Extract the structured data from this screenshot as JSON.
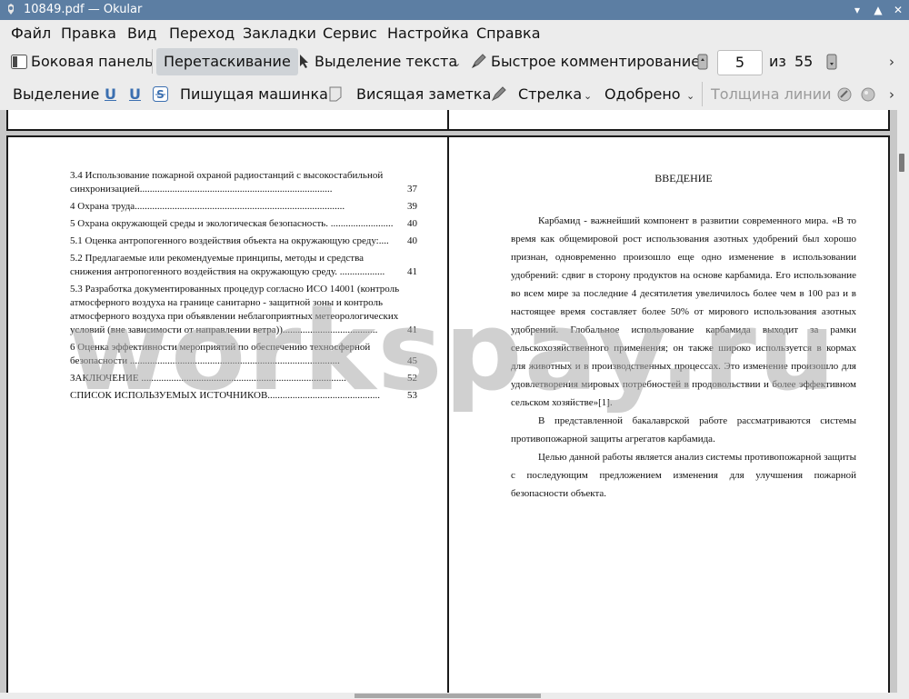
{
  "window": {
    "title": "10849.pdf  — Okular"
  },
  "menu": [
    "Файл",
    "Правка",
    "Вид",
    "Переход",
    "Закладки",
    "Сервис",
    "Настройка",
    "Справка"
  ],
  "toolbar1": {
    "sidebar": "Боковая панель",
    "browse": "Перетаскивание",
    "text_select": "Выделение текста",
    "quick_annot": "Быстрое комментирование",
    "page_current": "5",
    "of": "из",
    "page_total": "55"
  },
  "toolbar2": {
    "selection": "Выделение",
    "typewriter": "Пишущая машинка",
    "note": "Висящая заметка",
    "arrow": "Стрелка",
    "stamp": "Одобрено",
    "line_width": "Толщина линии"
  },
  "left_page": {
    "toc": [
      {
        "text": "3.4      Использование пожарной охраной радиостанций с высокостабильной синхронизацией.............................................................................",
        "page": "37"
      },
      {
        "text": "4 Охрана труда....................................................................................",
        "page": "39"
      },
      {
        "text": "5 Охрана окружающей среды и экологическая безопасность. .........................",
        "page": "40"
      },
      {
        "text": "5.1 Оценка антропогенного воздействия объекта на окружающую среду:....",
        "page": "40"
      },
      {
        "text": "5.2 Предлагаемые или рекомендуемые принципы, методы и средства снижения антропогенного воздействия на окружающую среду. ..................",
        "page": "41"
      },
      {
        "text": "5.3 Разработка документированных процедур согласно ИСО 14001 (контроль атмосферного воздуха на границе санитарно - защитной зоны и контроль атмосферного воздуха при объявлении неблагоприятных метеорологических условий (вне зависимости от направлении ветра))......................................",
        "page": "41"
      },
      {
        "text": "6 Оценка эффективности мероприятий по обеспечению техносферной безопасности ....................................................................................",
        "page": "45"
      },
      {
        "text": "ЗАКЛЮЧЕНИЕ ..................................................................................",
        "page": "52"
      },
      {
        "text": "СПИСОК ИСПОЛЬЗУЕМЫХ ИСТОЧНИКОВ.............................................",
        "page": "53"
      }
    ]
  },
  "right_page": {
    "heading": "ВВЕДЕНИЕ",
    "p1": "Карбамид - важнейший компонент в развитии современного мира. «В то время как общемировой рост использования азотных удобрений был хорошо признан, одновременно произошло еще одно изменение в использовании удобрений: сдвиг в сторону продуктов на основе карбамида. Его использование во всем мире за последние 4 десятилетия увеличилось более чем в 100 раз и в настоящее время составляет более 50% от мирового использования азотных удобрений. Глобальное использование карбамида выходит за рамки сельскохозяйственного применения; он также широко используется в кормах для животных и в производственных процессах. Это изменение произошло для удовлетворения мировых потребностей в продовольствии и более эффективном сельском хозяйстве»[1].",
    "p2": "В представленной бакалаврской работе рассматриваются системы противопожарной защиты агрегатов карбамида.",
    "p3": "Целью данной работы является анализ системы противопожарной защиты с последующим предложением изменения для улучшения пожарной безопасности объекта."
  },
  "watermark": "workspay.ru",
  "colors": {
    "titlebar": "#5c7ea3",
    "window_bg": "#ececec",
    "active_button": "#cfd3d7"
  }
}
